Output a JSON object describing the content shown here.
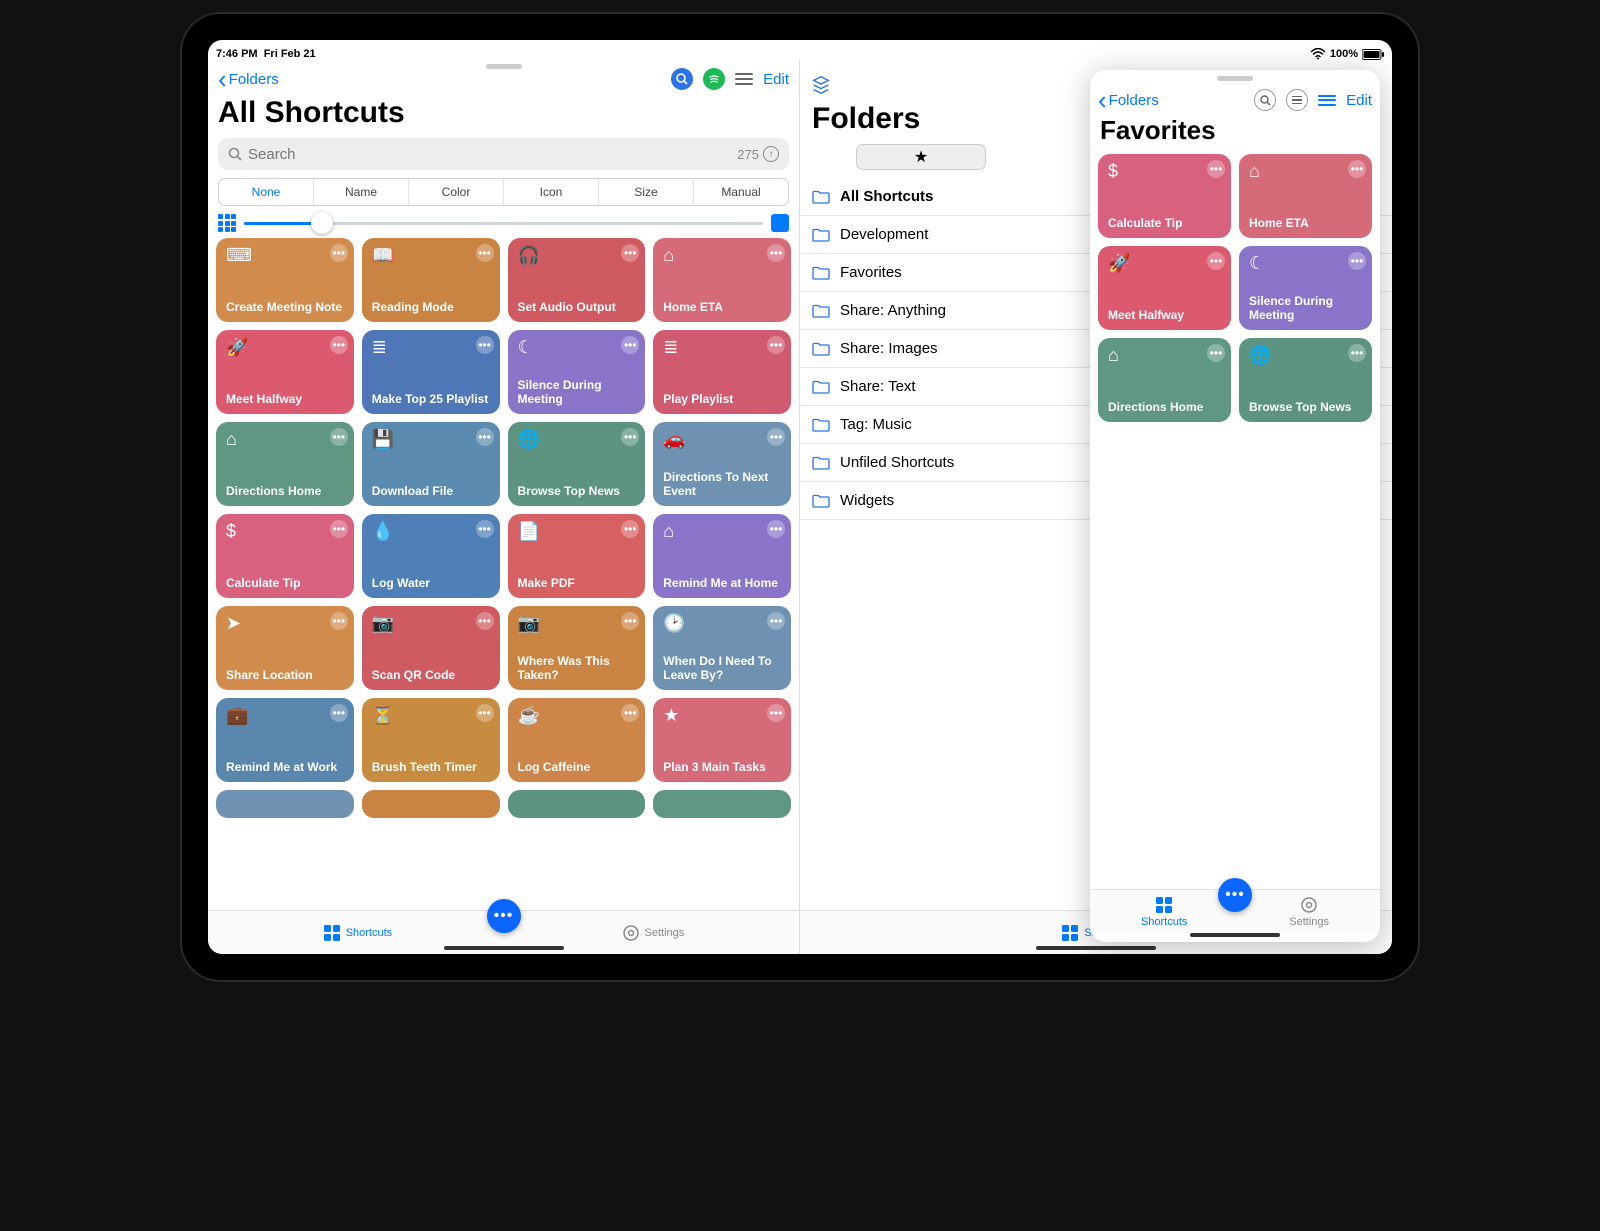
{
  "status": {
    "time": "7:46 PM",
    "date": "Fri Feb 21",
    "battery": "100%"
  },
  "left": {
    "folders_label": "Folders",
    "edit": "Edit",
    "title": "All Shortcuts",
    "search_placeholder": "Search",
    "count": "275",
    "sort": {
      "none": "None",
      "name": "Name",
      "color": "Color",
      "icon": "Icon",
      "size": "Size",
      "manual": "Manual"
    },
    "tabbar": {
      "shortcuts": "Shortcuts",
      "settings": "Settings"
    }
  },
  "folders_pane": {
    "title": "Folders",
    "items": [
      {
        "label": "All Shortcuts",
        "selected": true
      },
      {
        "label": "Development"
      },
      {
        "label": "Favorites"
      },
      {
        "label": "Share: Anything"
      },
      {
        "label": "Share: Images"
      },
      {
        "label": "Share: Text"
      },
      {
        "label": "Tag: Music"
      },
      {
        "label": "Unfiled Shortcuts"
      },
      {
        "label": "Widgets"
      }
    ],
    "tabbar": {
      "shortcuts": "Shortcuts"
    }
  },
  "slideover": {
    "folders_label": "Folders",
    "edit": "Edit",
    "title": "Favorites",
    "cards": [
      {
        "label": "Calculate Tip",
        "color": "#d8617f",
        "icon": "$"
      },
      {
        "label": "Home ETA",
        "color": "#d56a79",
        "icon": "⌂"
      },
      {
        "label": "Meet Halfway",
        "color": "#dc5a6f",
        "icon": "🚀"
      },
      {
        "label": "Silence During Meeting",
        "color": "#8a74c9",
        "icon": "☾"
      },
      {
        "label": "Directions Home",
        "color": "#5f9782",
        "icon": "⌂"
      },
      {
        "label": "Browse Top News",
        "color": "#5c9481",
        "icon": "🌐"
      }
    ],
    "tabbar": {
      "shortcuts": "Shortcuts",
      "settings": "Settings"
    }
  },
  "shortcuts": [
    {
      "label": "Create Meeting Note",
      "color": "#d18b4d",
      "icon": "⌨"
    },
    {
      "label": "Reading Mode",
      "color": "#c98443",
      "icon": "📖"
    },
    {
      "label": "Set Audio Output",
      "color": "#d05a62",
      "icon": "🎧"
    },
    {
      "label": "Home ETA",
      "color": "#d56a79",
      "icon": "⌂"
    },
    {
      "label": "Meet Halfway",
      "color": "#dc5a6f",
      "icon": "🚀"
    },
    {
      "label": "Make Top 25 Playlist",
      "color": "#4f77b8",
      "icon": "≣"
    },
    {
      "label": "Silence During Meeting",
      "color": "#8a74c9",
      "icon": "☾"
    },
    {
      "label": "Play Playlist",
      "color": "#d05a6f",
      "icon": "≣"
    },
    {
      "label": "Directions Home",
      "color": "#5f9782",
      "icon": "⌂"
    },
    {
      "label": "Download File",
      "color": "#5b8bb0",
      "icon": "💾"
    },
    {
      "label": "Browse Top News",
      "color": "#5c9481",
      "icon": "🌐"
    },
    {
      "label": "Directions To Next Event",
      "color": "#6f92b2",
      "icon": "🚗"
    },
    {
      "label": "Calculate Tip",
      "color": "#d8617f",
      "icon": "$"
    },
    {
      "label": "Log Water",
      "color": "#4e7fb6",
      "icon": "💧"
    },
    {
      "label": "Make PDF",
      "color": "#d66062",
      "icon": "📄"
    },
    {
      "label": "Remind Me at Home",
      "color": "#8a74c9",
      "icon": "⌂"
    },
    {
      "label": "Share Location",
      "color": "#d18b4d",
      "icon": "➤"
    },
    {
      "label": "Scan QR Code",
      "color": "#d05a62",
      "icon": "📷"
    },
    {
      "label": "Where Was This Taken?",
      "color": "#c98443",
      "icon": "📷"
    },
    {
      "label": "When Do I Need To Leave By?",
      "color": "#6f92b2",
      "icon": "🕑"
    },
    {
      "label": "Remind Me at Work",
      "color": "#5a85ac",
      "icon": "💼"
    },
    {
      "label": "Brush Teeth Timer",
      "color": "#c78c3f",
      "icon": "⏳"
    },
    {
      "label": "Log Caffeine",
      "color": "#ce854a",
      "icon": "☕"
    },
    {
      "label": "Plan 3 Main Tasks",
      "color": "#d56a79",
      "icon": "★"
    }
  ]
}
